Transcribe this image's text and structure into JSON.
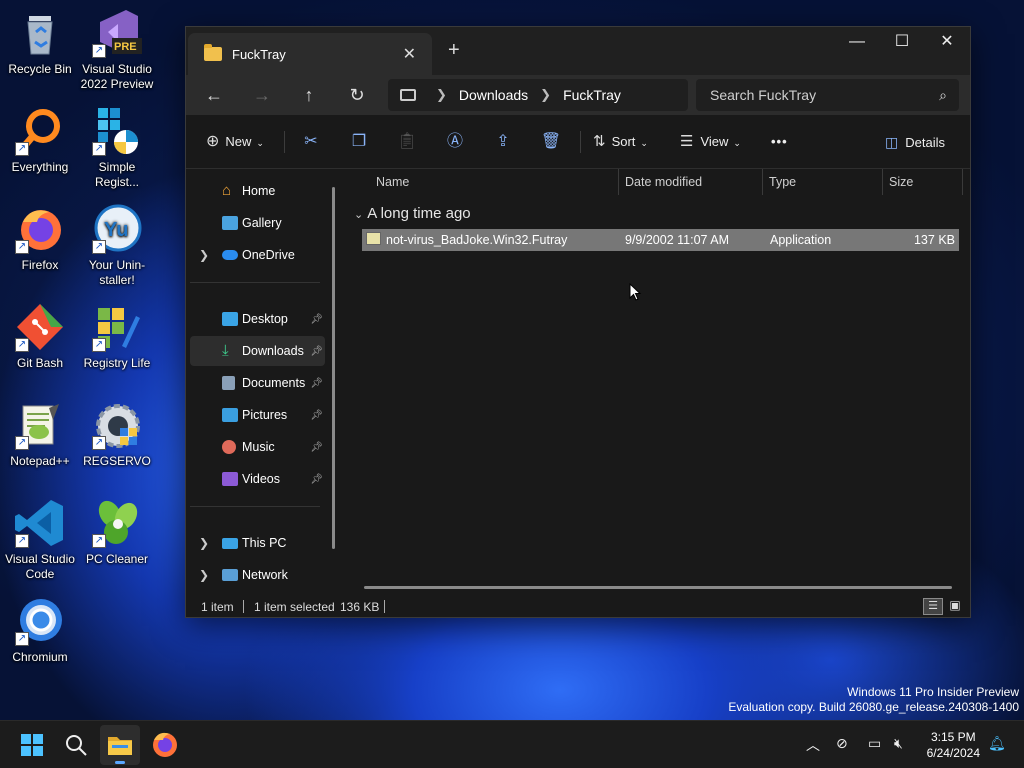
{
  "desktop": {
    "icons": [
      {
        "label": "Recycle Bin"
      },
      {
        "label": "Visual Studio 2022 Preview",
        "badge": "PRE"
      },
      {
        "label": "Everything"
      },
      {
        "label": "Simple Regist..."
      },
      {
        "label": "Firefox"
      },
      {
        "label": "Your Unin-staller!"
      },
      {
        "label": "Git Bash"
      },
      {
        "label": "Registry Life"
      },
      {
        "label": "Notepad++"
      },
      {
        "label": "REGSERVO"
      },
      {
        "label": "Visual Studio Code"
      },
      {
        "label": "PC Cleaner"
      },
      {
        "label": "Chromium"
      }
    ]
  },
  "explorer": {
    "tab_title": "FuckTray",
    "address": {
      "segments": [
        "Downloads",
        "FuckTray"
      ]
    },
    "search_placeholder": "Search FuckTray",
    "toolbar": {
      "new_label": "New",
      "sort_label": "Sort",
      "view_label": "View",
      "more_label": "•••",
      "details_label": "Details"
    },
    "sidebar": {
      "items": [
        "Home",
        "Gallery",
        "OneDrive",
        "Desktop",
        "Downloads",
        "Documents",
        "Pictures",
        "Music",
        "Videos",
        "This PC",
        "Network"
      ]
    },
    "columns": [
      "Name",
      "Date modified",
      "Type",
      "Size"
    ],
    "group_label": "A long time ago",
    "files": [
      {
        "name": "not-virus_BadJoke.Win32.Futray",
        "date": "9/9/2002 11:07 AM",
        "type": "Application",
        "size": "137 KB"
      }
    ],
    "status": {
      "count": "1 item",
      "selected": "1 item selected",
      "size": "136 KB"
    }
  },
  "watermark": {
    "line1": "Windows 11 Pro Insider Preview",
    "line2": "Evaluation copy. Build 26080.ge_release.240308-1400"
  },
  "taskbar": {
    "time": "3:15 PM",
    "date": "6/24/2024"
  },
  "colors": {
    "accent": "#5aa7ff",
    "folder": "#f1c04d",
    "selection": "#777777"
  }
}
